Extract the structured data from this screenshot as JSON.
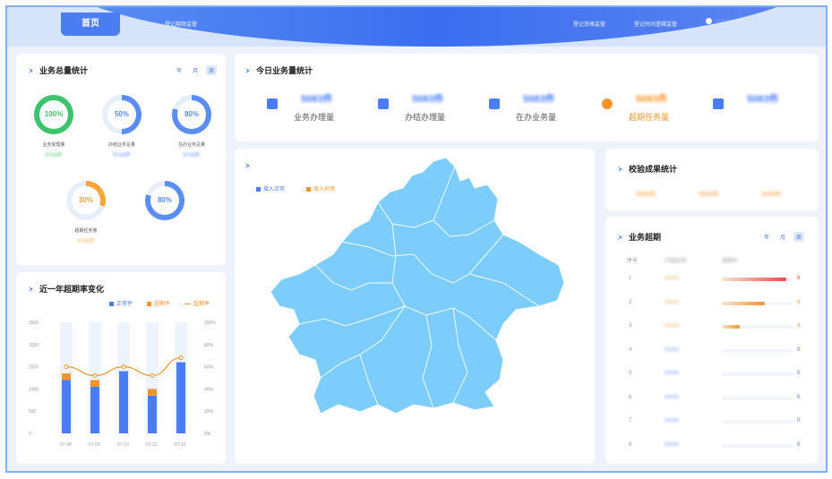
{
  "nav": {
    "home": "首页",
    "items": [
      "登记期限监管",
      "登记资格监管",
      "登记时间逻辑监管"
    ],
    "user": "——————"
  },
  "stats_panel": {
    "title": "业务总量统计",
    "tabs": [
      "年",
      "月",
      "周"
    ],
    "active_tab": "周",
    "rings": [
      {
        "pct": "100%",
        "label": "业务受理量",
        "value": "5743件",
        "color": "#3bc46d",
        "fill": 1.0
      },
      {
        "pct": "50%",
        "label": "办结业务总量",
        "value": "5743件",
        "color": "#5b8ef5",
        "fill": 0.5
      },
      {
        "pct": "80%",
        "label": "在办业务总量",
        "value": "5743件",
        "color": "#5b8ef5",
        "fill": 0.8
      },
      {
        "pct": "30%",
        "label": "超期任务量",
        "value": "5743件",
        "color": "#f5a53b",
        "fill": 0.3
      },
      {
        "pct": "80%",
        "label": "",
        "value": "",
        "color": "#5b8ef5",
        "fill": 0.8
      }
    ]
  },
  "today_panel": {
    "title": "今日业务量统计",
    "items": [
      {
        "value": "5083件",
        "label": "业务办理量",
        "icon": "briefcase-icon",
        "color": "#4a7cf5"
      },
      {
        "value": "5083件",
        "label": "办结办理量",
        "icon": "document-icon",
        "color": "#4a7cf5"
      },
      {
        "value": "5083件",
        "label": "在办业务量",
        "icon": "book-icon",
        "color": "#4a7cf5"
      },
      {
        "value": "5083件",
        "label": "超期任务量",
        "icon": "clock-icon",
        "color": "#f5942b"
      },
      {
        "value": "5083件",
        "label": "",
        "icon": "id-card-icon",
        "color": "#4a7cf5"
      }
    ]
  },
  "map_panel": {
    "legend": [
      {
        "label": "接入正常",
        "color": "#4a7cf5"
      },
      {
        "label": "接入异常",
        "color": "#f5942b"
      }
    ],
    "region_color": "#7ccdfb"
  },
  "check_panel": {
    "title": "校验成果统计",
    "values": [
      "5083件",
      "5083件",
      "5083件"
    ]
  },
  "overdue_panel": {
    "title": "业务超期",
    "tabs": [
      "年",
      "月",
      "周"
    ],
    "active_tab": "周",
    "headers": [
      "序号",
      "行政区划",
      "超期件"
    ],
    "rows": [
      {
        "no": "1",
        "region": "XXXX",
        "bar": 0.9,
        "count": "8",
        "color": "#f04848"
      },
      {
        "no": "2",
        "region": "XXXX",
        "bar": 0.6,
        "count": "6",
        "color": "#f5942b"
      },
      {
        "no": "3",
        "region": "XXXX",
        "bar": 0.25,
        "count": "3",
        "color": "#f5942b"
      },
      {
        "no": "4",
        "region": "XXXX",
        "bar": 0,
        "count": "0",
        "color": "#4a7cf5"
      },
      {
        "no": "5",
        "region": "XXXX",
        "bar": 0,
        "count": "0",
        "color": "#4a7cf5"
      },
      {
        "no": "6",
        "region": "XXXX",
        "bar": 0,
        "count": "0",
        "color": "#4a7cf5"
      },
      {
        "no": "7",
        "region": "XXXX",
        "bar": 0,
        "count": "0",
        "color": "#4a7cf5"
      },
      {
        "no": "8",
        "region": "XXXX",
        "bar": 0,
        "count": "0",
        "color": "#4a7cf5"
      }
    ]
  },
  "trend_panel": {
    "title": "近一年超期率变化",
    "legend": [
      {
        "label": "正常件",
        "color": "#4a7cf5"
      },
      {
        "label": "超期件",
        "color": "#f5942b"
      },
      {
        "label": "超期率",
        "color": "#f5942b"
      }
    ]
  },
  "chart_data": {
    "type": "bar",
    "categories": [
      "07-08",
      "07-09",
      "07-10",
      "07-11",
      "07-12"
    ],
    "series": [
      {
        "name": "正常件",
        "values": [
          1200,
          1050,
          1400,
          850,
          1600
        ]
      },
      {
        "name": "超期件",
        "values": [
          150,
          150,
          0,
          150,
          0
        ]
      },
      {
        "name": "超期率",
        "values": [
          60,
          52,
          60,
          52,
          68
        ]
      }
    ],
    "y_left_ticks": [
      "2500",
      "2000",
      "1500",
      "1000",
      "500",
      "0"
    ],
    "y_right_ticks": [
      "100%",
      "80%",
      "60%",
      "40%",
      "20%",
      "0%"
    ],
    "ylim": [
      0,
      2500
    ],
    "y2lim": [
      0,
      100
    ]
  }
}
